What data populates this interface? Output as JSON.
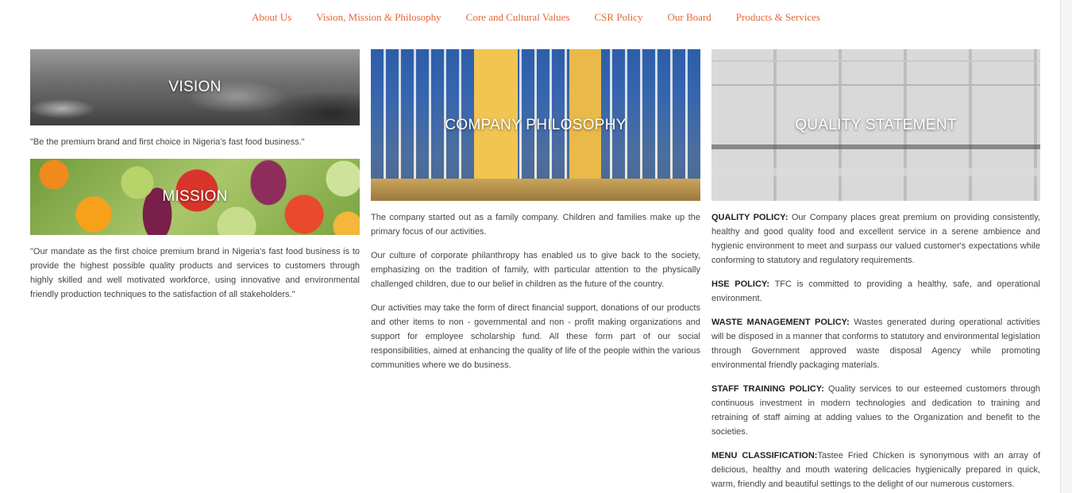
{
  "nav": {
    "items": [
      "About Us",
      "Vision, Mission & Philosophy",
      "Core and Cultural Values",
      "CSR Policy",
      "Our Board",
      "Products & Services"
    ]
  },
  "colors": {
    "nav_link": "#e2683a",
    "body_text": "#444444"
  },
  "vision": {
    "title": "VISION",
    "quote": "\"Be the premium brand and first choice in Nigeria's fast food business.\""
  },
  "mission": {
    "title": "MISSION",
    "quote": "\"Our mandate as the first choice premium brand in Nigeria's fast food business is to provide the highest possible quality products and services to customers through highly skilled and well motivated workforce, using innovative and environmental friendly production techniques to the satisfaction of all stakeholders.\""
  },
  "philosophy": {
    "title": "COMPANY PHILOSOPHY",
    "paragraphs": [
      "The company started out as a family company. Children and families make up the primary focus of our activities.",
      "Our culture of corporate philanthropy has enabled us to give back to the society, emphasizing on the tradition of family, with particular attention to the physically challenged children, due to our belief in children as the future of the country.",
      "Our activities may take the form of direct financial support, donations of our products and other items to non - governmental and non - profit making organizations and support for employee scholarship fund. All these form part of our social responsibilities, aimed at enhancing the quality of life of the people within the various communities where we do business."
    ]
  },
  "quality": {
    "title": "QUALITY STATEMENT",
    "policies": [
      {
        "label": "QUALITY POLICY:",
        "text": " Our Company places great premium on providing consistently, healthy and good quality food and excellent service in a serene ambience and hygienic environment to meet and surpass our valued customer's expectations while conforming to statutory and regulatory requirements."
      },
      {
        "label": "HSE POLICY:",
        "text": " TFC is committed to providing a healthy, safe, and operational environment."
      },
      {
        "label": "WASTE MANAGEMENT POLICY:",
        "text": " Wastes generated during operational activities will be disposed in a manner that conforms to statutory and environmental legislation through Government approved waste disposal Agency while promoting environmental friendly packaging materials."
      },
      {
        "label": "STAFF TRAINING POLICY:",
        "text": " Quality services to our esteemed customers through continuous investment in modern technologies and dedication to training and retraining of staff aiming at adding values to the Organization and benefit to the societies."
      },
      {
        "label": "MENU CLASSIFICATION:",
        "text": "Tastee Fried Chicken is synonymous with an array of delicious, healthy and mouth watering delicacies hygienically prepared in quick, warm, friendly and beautiful settings to the delight of our numerous customers."
      }
    ]
  }
}
